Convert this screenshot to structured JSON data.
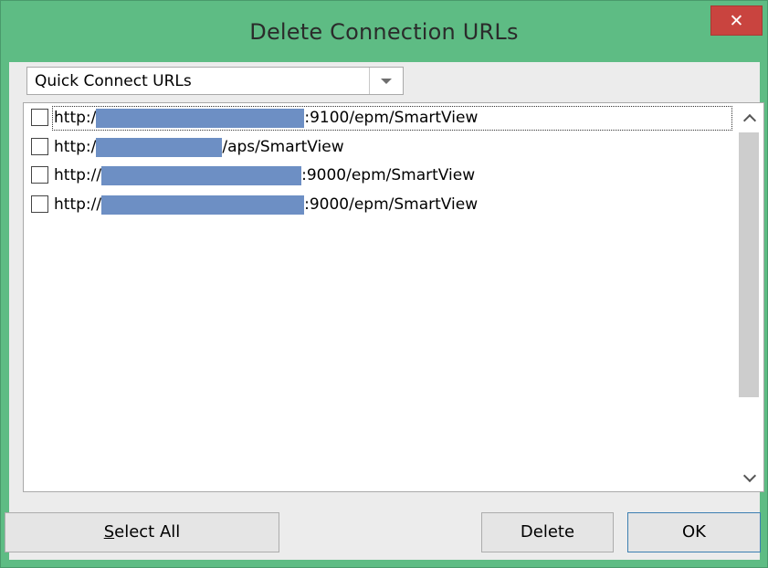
{
  "window": {
    "title": "Delete Connection URLs",
    "close_label": "✕"
  },
  "dropdown": {
    "selected": "Quick Connect URLs"
  },
  "urls": [
    {
      "prefix": "http:/",
      "suffix": ":9100/epm/SmartView",
      "checked": false
    },
    {
      "prefix": "http:/",
      "suffix": "/aps/SmartView",
      "checked": false
    },
    {
      "prefix": "http://",
      "suffix": ":9000/epm/SmartView",
      "checked": false
    },
    {
      "prefix": "http://",
      "suffix": ":9000/epm/SmartView",
      "checked": false
    }
  ],
  "buttons": {
    "select_all": "Select All",
    "select_all_mnemonic": "S",
    "delete": "Delete",
    "ok": "OK"
  },
  "colors": {
    "title_bar": "#5ebc84",
    "close_button": "#c9443f",
    "redaction": "#6d8fc4",
    "default_button_border": "#3c7fb1"
  }
}
